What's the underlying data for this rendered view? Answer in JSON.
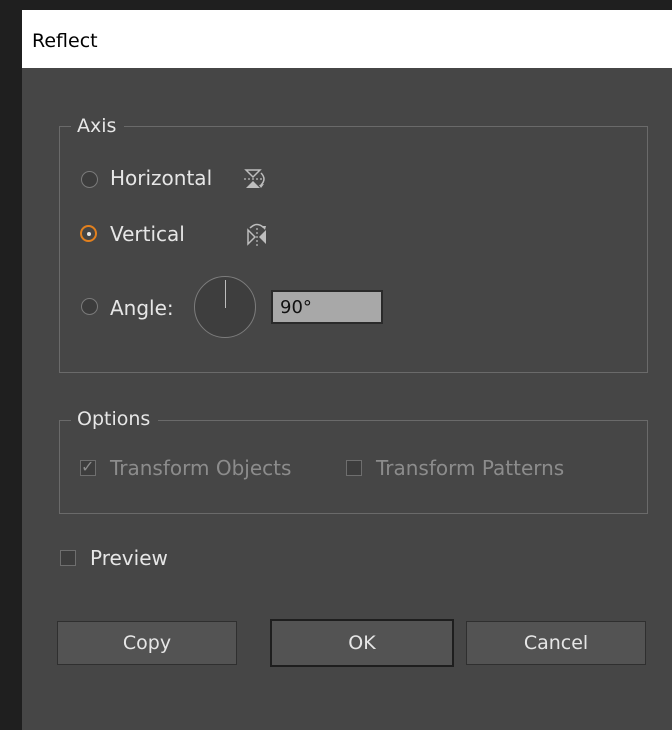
{
  "window": {
    "title": "Reflect"
  },
  "axis": {
    "legend": "Axis",
    "horizontal_label": "Horizontal",
    "vertical_label": "Vertical",
    "angle_label": "Angle:",
    "angle_value": "90°",
    "selected": "vertical"
  },
  "options": {
    "legend": "Options",
    "transform_objects_label": "Transform Objects",
    "transform_objects_checked": true,
    "transform_patterns_label": "Transform Patterns",
    "transform_patterns_checked": false
  },
  "preview": {
    "label": "Preview",
    "checked": false
  },
  "buttons": {
    "copy": "Copy",
    "ok": "OK",
    "cancel": "Cancel"
  },
  "colors": {
    "accent": "#e2801e",
    "background": "#464646",
    "text": "#e6e6e6"
  }
}
